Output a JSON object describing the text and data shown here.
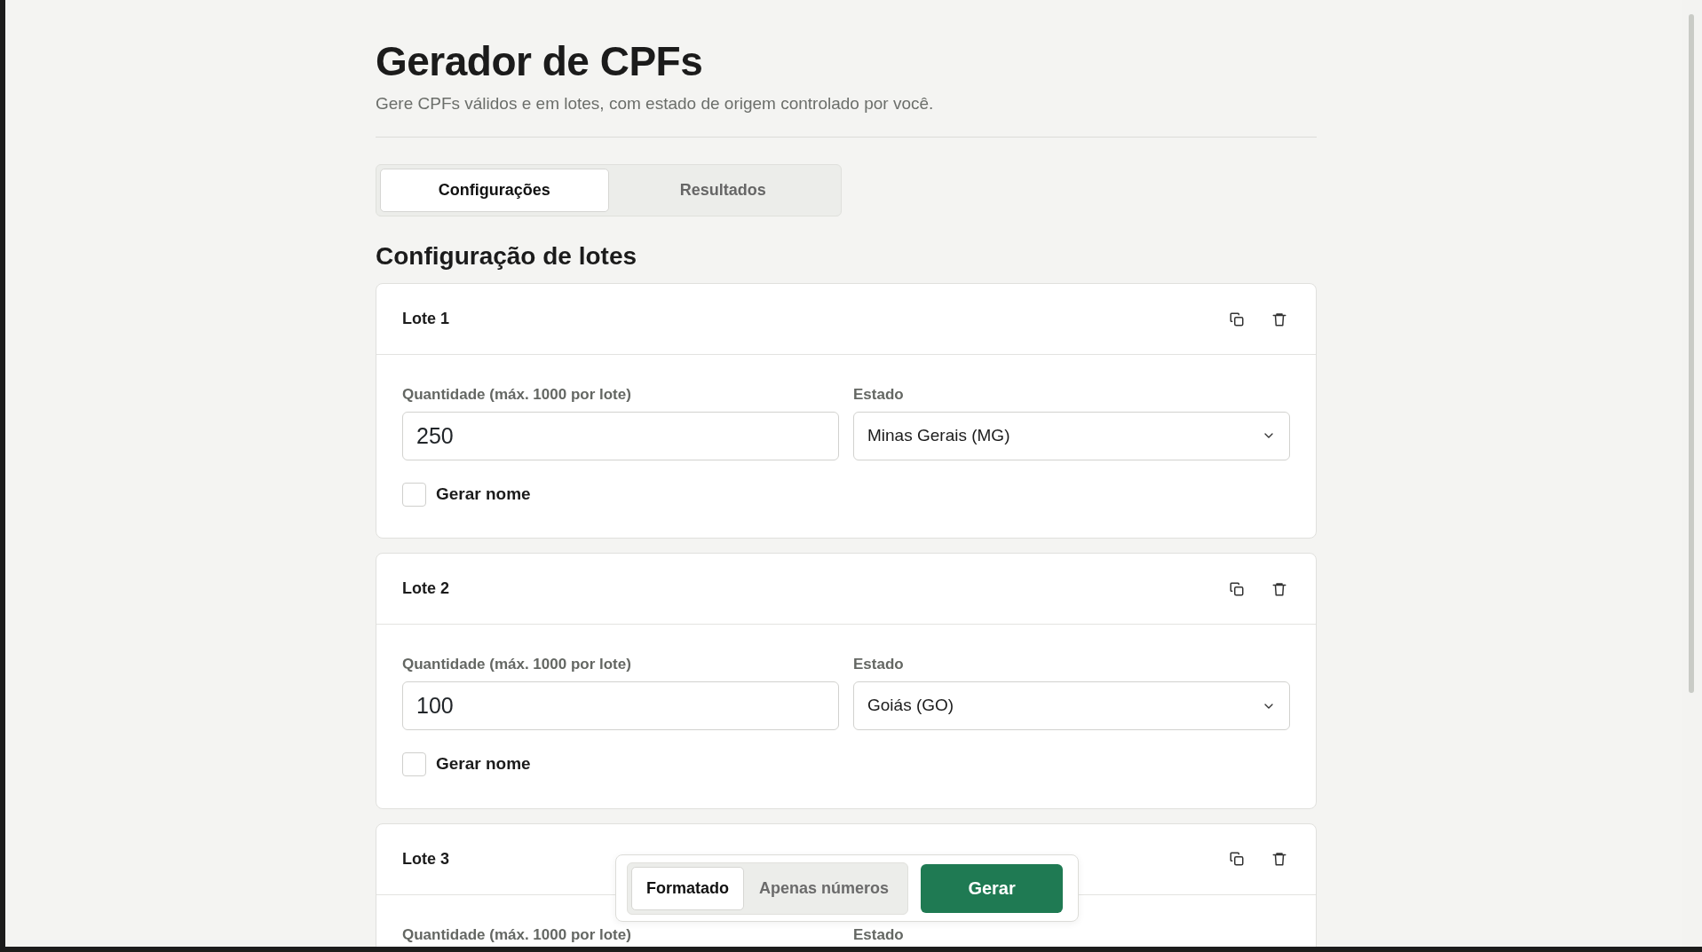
{
  "header": {
    "title": "Gerador de CPFs",
    "subtitle": "Gere CPFs válidos e em lotes, com estado de origem controlado por você."
  },
  "tabs": [
    {
      "label": "Configurações",
      "selected": true
    },
    {
      "label": "Resultados",
      "selected": false
    }
  ],
  "section_title": "Configuração de lotes",
  "lots": [
    {
      "title": "Lote 1",
      "quantity": {
        "label": "Quantidade (máx. 1000 por lote)",
        "value": "250"
      },
      "state": {
        "label": "Estado",
        "value": "Minas Gerais (MG)"
      },
      "generate_name": {
        "label": "Gerar nome",
        "checked": false
      }
    },
    {
      "title": "Lote 2",
      "quantity": {
        "label": "Quantidade (máx. 1000 por lote)",
        "value": "100"
      },
      "state": {
        "label": "Estado",
        "value": "Goiás (GO)"
      },
      "generate_name": {
        "label": "Gerar nome",
        "checked": false
      }
    },
    {
      "title": "Lote 3",
      "quantity": {
        "label": "Quantidade (máx. 1000 por lote)"
      },
      "state": {
        "label": "Estado"
      }
    }
  ],
  "format_toggle": [
    {
      "label": "Formatado",
      "selected": true
    },
    {
      "label": "Apenas números",
      "selected": false
    }
  ],
  "generate_button": "Gerar"
}
